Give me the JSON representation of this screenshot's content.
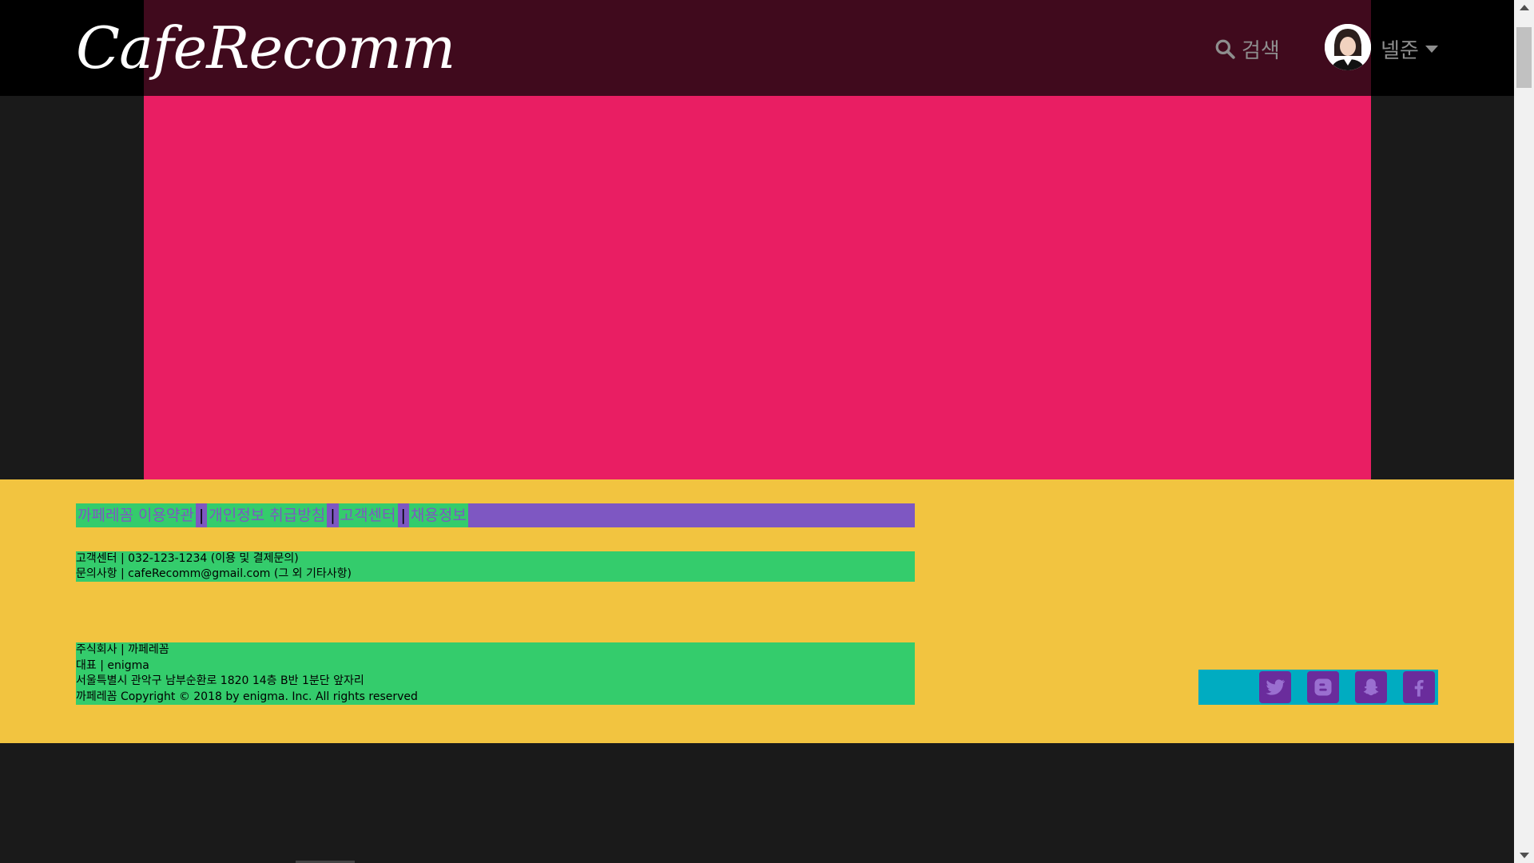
{
  "header": {
    "logo_text": "CafeRecomm",
    "search_label": "검색",
    "user_name": "넬준"
  },
  "footer": {
    "links": [
      "까페레꼼 이용약관",
      "개인정보 취급방침",
      "고객센터",
      "채용정보"
    ],
    "separator": "|",
    "contact_lines": [
      "고객센터 | 032-123-1234 (이용 및 결제문의)",
      "문의사항 | cafeRecomm@gmail.com (그 외 기타사항)"
    ],
    "company_lines": [
      "주식회사 | 까페레꼼",
      "대표 | enigma",
      "서울특별시 관악구 남부순환로 1820 14층 B반 1분단 앞자리",
      "까페레꼼 Copyright © 2018 by enigma. Inc. All rights reserved"
    ],
    "social": [
      "twitter-icon",
      "blogger-icon",
      "snapchat-icon",
      "facebook-icon"
    ]
  },
  "colors": {
    "header_bg": "#000000",
    "header_center": "#400a1d",
    "hero": "#e91e63",
    "footer_bg": "#f2c440",
    "links_bg": "#7e57c2",
    "green_block": "#34cc6c",
    "social_bg": "#00acc1",
    "social_btn": "#6a2c9c"
  }
}
